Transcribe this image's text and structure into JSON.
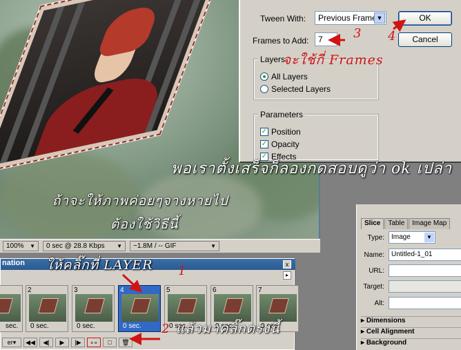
{
  "document": {
    "status": {
      "zoom": "100%",
      "download": "0 sec @ 28.8 Kbps",
      "size": "~1.8M / -- GIF"
    }
  },
  "tween_dialog": {
    "tween_with_label": "Tween With:",
    "tween_with_value": "Previous Frame",
    "frames_to_add_label": "Frames to Add:",
    "frames_to_add_value": "7",
    "ok_label": "OK",
    "cancel_label": "Cancel",
    "layers_group": "Layers",
    "all_layers": "All Layers",
    "selected_layers": "Selected Layers",
    "parameters_group": "Parameters",
    "position": "Position",
    "opacity": "Opacity",
    "effects": "Effects"
  },
  "animation_palette": {
    "title": "nation",
    "close": "x",
    "menu": "▸",
    "frames": [
      {
        "num": "",
        "delay": "sec."
      },
      {
        "num": "2",
        "delay": "0 sec."
      },
      {
        "num": "3",
        "delay": "0 sec."
      },
      {
        "num": "4",
        "delay": "0 sec."
      },
      {
        "num": "5",
        "delay": "0 sec."
      },
      {
        "num": "6",
        "delay": "0 sec."
      },
      {
        "num": "7",
        "delay": "0 sec."
      }
    ],
    "loop": "er"
  },
  "slice_palette": {
    "tabs": [
      "Slice",
      "Table",
      "Image Map"
    ],
    "type_label": "Type:",
    "type_value": "Image",
    "name_label": "Name:",
    "name_value": "Untitled-1_01",
    "url_label": "URL:",
    "target_label": "Target:",
    "alt_label": "Alt:",
    "sections": [
      "Dimensions",
      "Cell Alignment",
      "Background"
    ]
  },
  "annotations": {
    "num1": "1",
    "num2": "2",
    "num3": "3",
    "num4": "4",
    "frames_thai": "จะใช้กี่ Frames",
    "try_ok_thai": "พอเราตั้งเสร็จก็ลองกดสอบดูว่า ok เปล่า",
    "fade_thai_1": "ถ้าจะให้ภาพค่อยๆจางหายไป",
    "fade_thai_2": "ต้องใช้วิธีนี้",
    "click_layer_thai": "ให้คลิ๊กที่ LAYER",
    "then_click_thai": "แล้วมาคลิ๊กตรงนี้"
  },
  "colors": {
    "annotation_red": "#d01414",
    "selection_blue": "#316ac5"
  }
}
